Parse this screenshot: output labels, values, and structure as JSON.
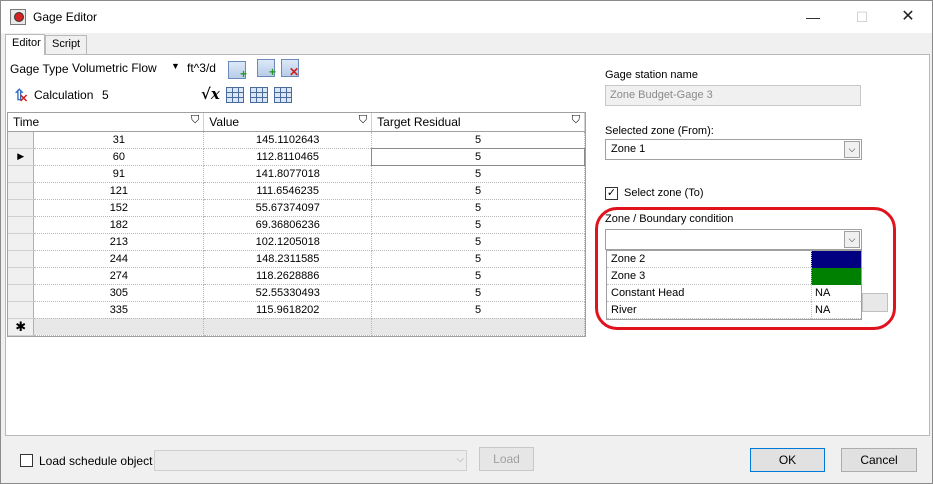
{
  "window": {
    "title": "Gage Editor",
    "minimize": "—",
    "maximize": "☐",
    "close": "✕"
  },
  "tabs": [
    {
      "label": "Editor"
    },
    {
      "label": "Script"
    }
  ],
  "toolbar": {
    "gage_type_label": "Gage Type",
    "gage_type_value": "Volumetric Flow",
    "unit": "ft^3/d",
    "calculation_label": "Calculation",
    "calculation_value": "5",
    "sqrt_symbol": "√x"
  },
  "table": {
    "columns": [
      "Time",
      "Value",
      "Target Residual"
    ],
    "current_row_marker": "▶",
    "new_row_marker": "✱",
    "rows": [
      [
        "31",
        "145.1102643",
        "5"
      ],
      [
        "60",
        "112.8110465",
        "5"
      ],
      [
        "91",
        "141.8077018",
        "5"
      ],
      [
        "121",
        "111.6546235",
        "5"
      ],
      [
        "152",
        "55.67374097",
        "5"
      ],
      [
        "182",
        "69.36806236",
        "5"
      ],
      [
        "213",
        "102.1205018",
        "5"
      ],
      [
        "244",
        "148.2311585",
        "5"
      ],
      [
        "274",
        "118.2628886",
        "5"
      ],
      [
        "305",
        "52.55330493",
        "5"
      ],
      [
        "335",
        "115.9618202",
        "5"
      ]
    ]
  },
  "right_panel": {
    "gage_station_label": "Gage station name",
    "gage_station_value": "Zone Budget-Gage 3",
    "selected_zone_label": "Selected zone (From):",
    "selected_zone_value": "Zone 1",
    "select_zone_to_label": "Select zone (To)",
    "select_zone_to_checked": "✓",
    "zone_boundary_label": "Zone / Boundary condition",
    "zone_boundary_value": "",
    "zone_options": [
      {
        "name": "Zone 2",
        "value": "",
        "color": "#000080"
      },
      {
        "name": "Zone 3",
        "value": "",
        "color": "#008000"
      },
      {
        "name": "Constant Head",
        "value": "NA",
        "color": ""
      },
      {
        "name": "River",
        "value": "NA",
        "color": ""
      }
    ],
    "highlight_color": "#e0131d"
  },
  "bottom": {
    "load_schedule_label": "Load schedule object",
    "load_button": "Load",
    "ok_button": "OK",
    "cancel_button": "Cancel"
  }
}
